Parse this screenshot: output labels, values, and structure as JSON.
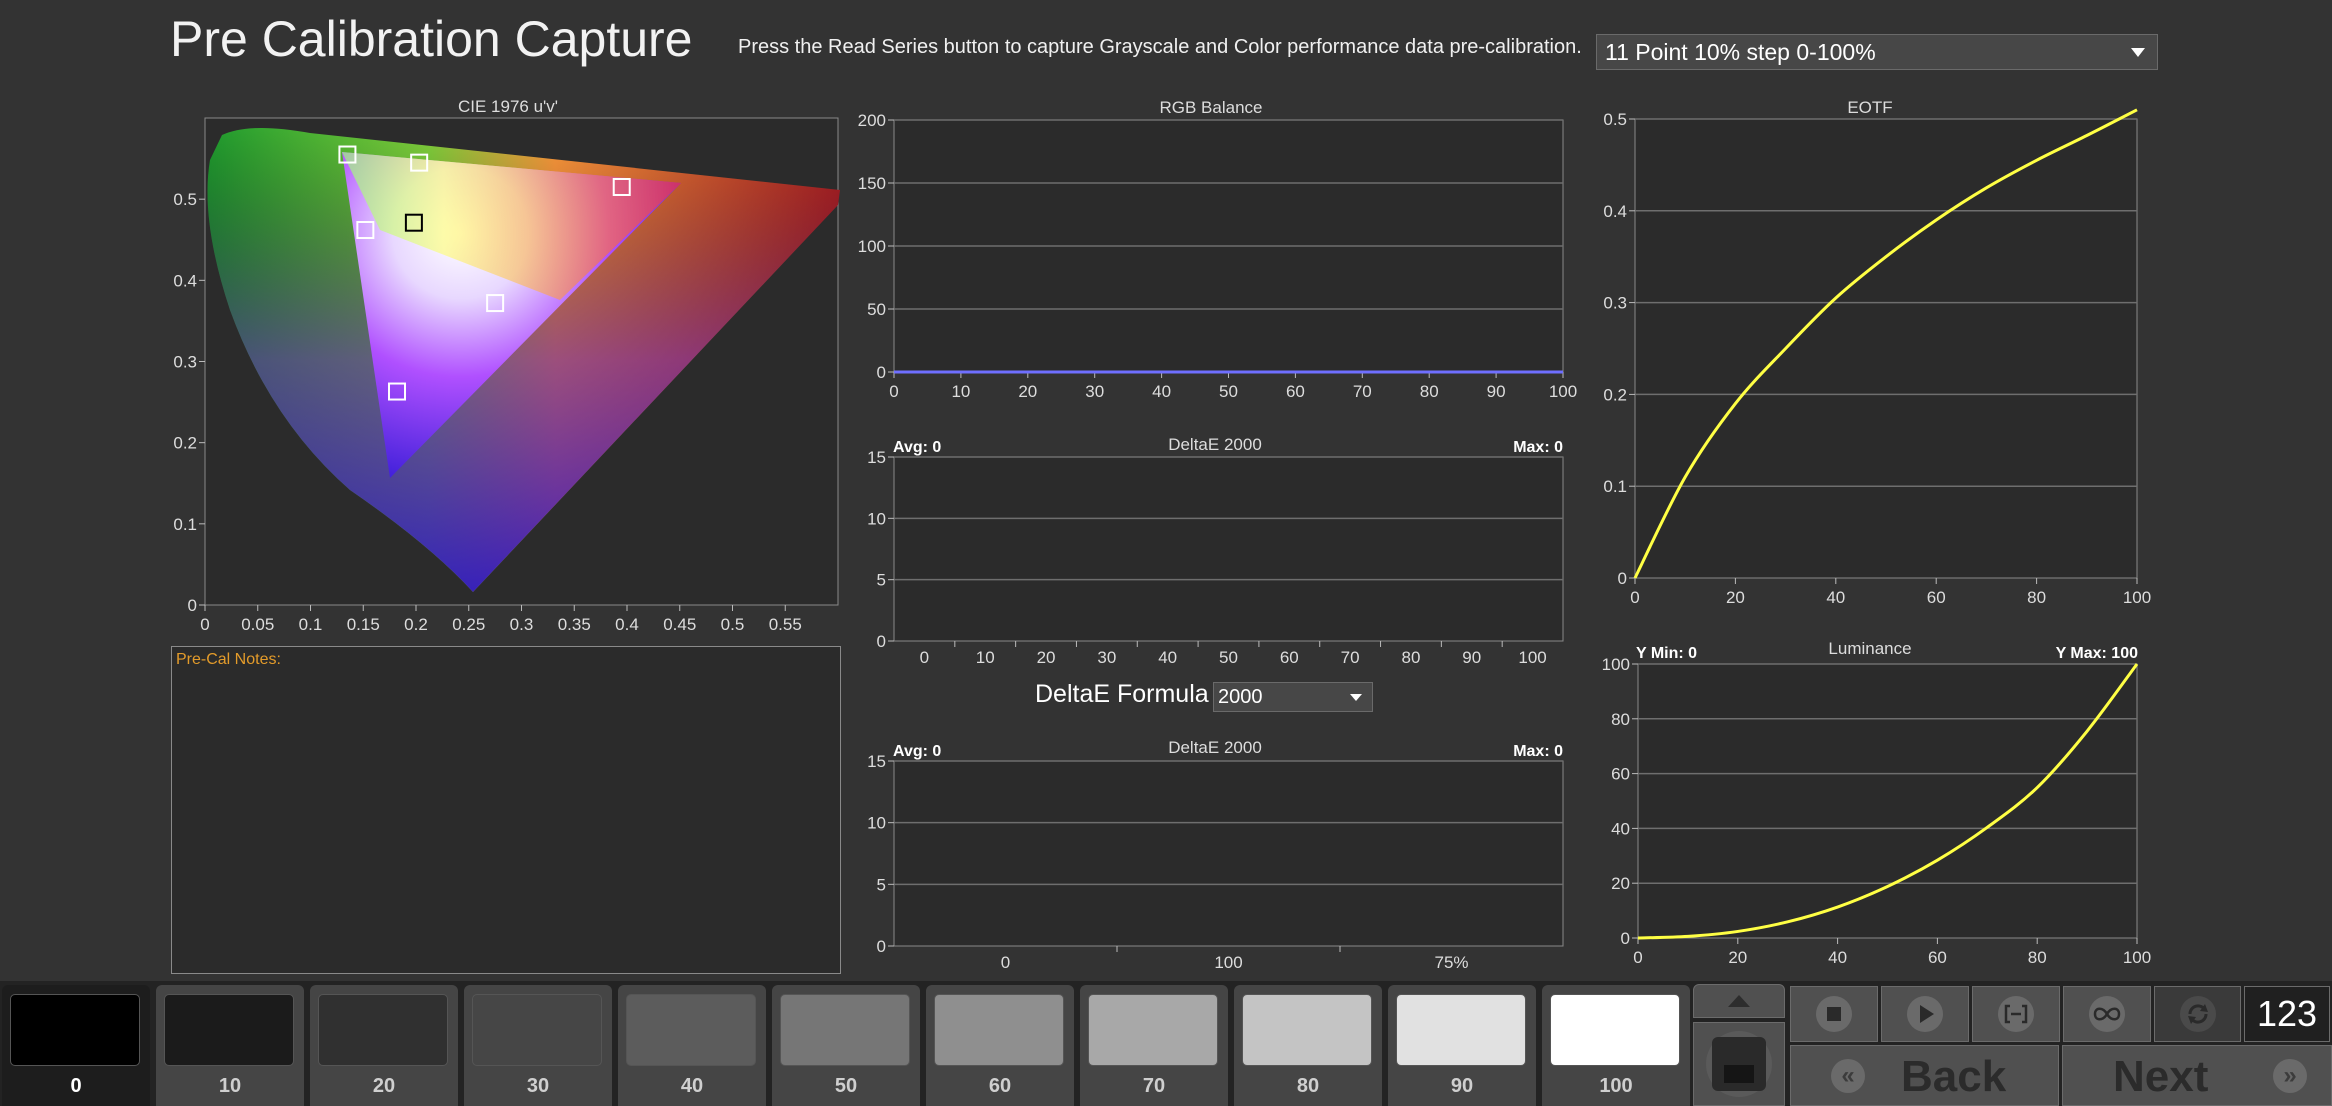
{
  "page_title": "Pre Calibration Capture",
  "instruction": "Press the Read Series button to capture Grayscale and Color performance data pre-calibration.",
  "series_select": {
    "value": "11 Point 10% step 0-100%"
  },
  "notes": {
    "label": "Pre-Cal Notes:",
    "content": ""
  },
  "deltae_formula": {
    "label": "DeltaE Formula",
    "value": "2000"
  },
  "colors": {
    "background": "#333333",
    "plot_background": "#2b2b2b",
    "gridline": "#6e6e6e",
    "curve": "#ffff44",
    "rgb_line": "#6f6fff",
    "notes_label": "#e39b2a"
  },
  "chart_data": [
    {
      "id": "cie",
      "type": "scatter",
      "title": "CIE 1976 u'v'",
      "xlim": [
        0,
        0.6
      ],
      "ylim": [
        0,
        0.6
      ],
      "x_ticks": [
        "0",
        "0.05",
        "0.1",
        "0.15",
        "0.2",
        "0.25",
        "0.3",
        "0.35",
        "0.4",
        "0.45",
        "0.5",
        "0.55"
      ],
      "y_ticks": [
        "0",
        "0.1",
        "0.2",
        "0.3",
        "0.4",
        "0.5"
      ],
      "points": [
        {
          "name": "green-target",
          "u": 0.135,
          "v": 0.555,
          "marker": "white"
        },
        {
          "name": "yellow-target",
          "u": 0.203,
          "v": 0.545,
          "marker": "white"
        },
        {
          "name": "red-target",
          "u": 0.395,
          "v": 0.515,
          "marker": "white"
        },
        {
          "name": "cyan-target",
          "u": 0.152,
          "v": 0.462,
          "marker": "white"
        },
        {
          "name": "white-point",
          "u": 0.198,
          "v": 0.471,
          "marker": "black"
        },
        {
          "name": "magenta-target",
          "u": 0.275,
          "v": 0.372,
          "marker": "white"
        },
        {
          "name": "blue-target",
          "u": 0.182,
          "v": 0.263,
          "marker": "white"
        }
      ]
    },
    {
      "id": "rgb",
      "type": "line",
      "title": "RGB Balance",
      "xlim": [
        0,
        100
      ],
      "ylim": [
        0,
        200
      ],
      "x_ticks": [
        "0",
        "10",
        "20",
        "30",
        "40",
        "50",
        "60",
        "70",
        "80",
        "90",
        "100"
      ],
      "y_ticks": [
        "0",
        "50",
        "100",
        "150",
        "200"
      ],
      "series": [
        {
          "x": [
            0,
            10,
            20,
            30,
            40,
            50,
            60,
            70,
            80,
            90,
            100
          ],
          "y": [
            0,
            0,
            0,
            0,
            0,
            0,
            0,
            0,
            0,
            0,
            0
          ]
        }
      ]
    },
    {
      "id": "de1",
      "type": "bar",
      "title": "DeltaE 2000",
      "avg_label": "Avg: 0",
      "max_label": "Max: 0",
      "ylim": [
        0,
        15
      ],
      "categories": [
        "0",
        "10",
        "20",
        "30",
        "40",
        "50",
        "60",
        "70",
        "80",
        "90",
        "100"
      ],
      "y_ticks": [
        "0",
        "5",
        "10",
        "15"
      ],
      "values": [
        0,
        0,
        0,
        0,
        0,
        0,
        0,
        0,
        0,
        0,
        0
      ]
    },
    {
      "id": "de2",
      "type": "bar",
      "title": "DeltaE 2000",
      "avg_label": "Avg: 0",
      "max_label": "Max: 0",
      "ylim": [
        0,
        15
      ],
      "categories": [
        "0",
        "100",
        "75%"
      ],
      "y_ticks": [
        "0",
        "5",
        "10",
        "15"
      ],
      "values": [
        0,
        0,
        0
      ]
    },
    {
      "id": "eotf",
      "type": "line",
      "title": "EOTF",
      "xlim": [
        0,
        100
      ],
      "ylim": [
        0,
        0.5
      ],
      "x_ticks": [
        "0",
        "20",
        "40",
        "60",
        "80",
        "100"
      ],
      "y_ticks": [
        "0",
        "0.1",
        "0.2",
        "0.3",
        "0.4",
        "0.5"
      ],
      "series": [
        {
          "x": [
            0,
            10,
            20,
            30,
            40,
            50,
            60,
            70,
            80,
            90,
            100
          ],
          "y": [
            0,
            0.11,
            0.19,
            0.25,
            0.305,
            0.35,
            0.39,
            0.425,
            0.455,
            0.482,
            0.51
          ]
        }
      ]
    },
    {
      "id": "lum",
      "type": "line",
      "title": "Luminance",
      "ymin_label": "Y Min: 0",
      "ymax_label": "Y Max: 100",
      "xlim": [
        0,
        100
      ],
      "ylim": [
        0,
        100
      ],
      "x_ticks": [
        "0",
        "20",
        "40",
        "60",
        "80",
        "100"
      ],
      "y_ticks": [
        "0",
        "20",
        "40",
        "60",
        "80",
        "100"
      ],
      "series": [
        {
          "x": [
            0,
            10,
            20,
            30,
            40,
            50,
            60,
            70,
            80,
            90,
            100
          ],
          "y": [
            0,
            0.6,
            2.4,
            5.9,
            11.3,
            18.8,
            28.4,
            40.4,
            54.9,
            75.5,
            100
          ]
        }
      ]
    }
  ],
  "swatches": [
    {
      "label": "0",
      "color": "#000000"
    },
    {
      "label": "10",
      "color": "#1b1b1b"
    },
    {
      "label": "20",
      "color": "#303030"
    },
    {
      "label": "30",
      "color": "#464646"
    },
    {
      "label": "40",
      "color": "#5c5c5c"
    },
    {
      "label": "50",
      "color": "#767676"
    },
    {
      "label": "60",
      "color": "#8f8f8f"
    },
    {
      "label": "70",
      "color": "#a8a8a8"
    },
    {
      "label": "80",
      "color": "#c4c4c4"
    },
    {
      "label": "90",
      "color": "#e1e1e1"
    },
    {
      "label": "100",
      "color": "#ffffff"
    }
  ],
  "controls": {
    "counter": "123",
    "back_label": "Back",
    "next_label": "Next",
    "icons": [
      "triangle-up-icon",
      "stop-square-icon",
      "stop-icon",
      "play-icon",
      "bracket-icon",
      "infinity-icon",
      "refresh-icon"
    ]
  }
}
